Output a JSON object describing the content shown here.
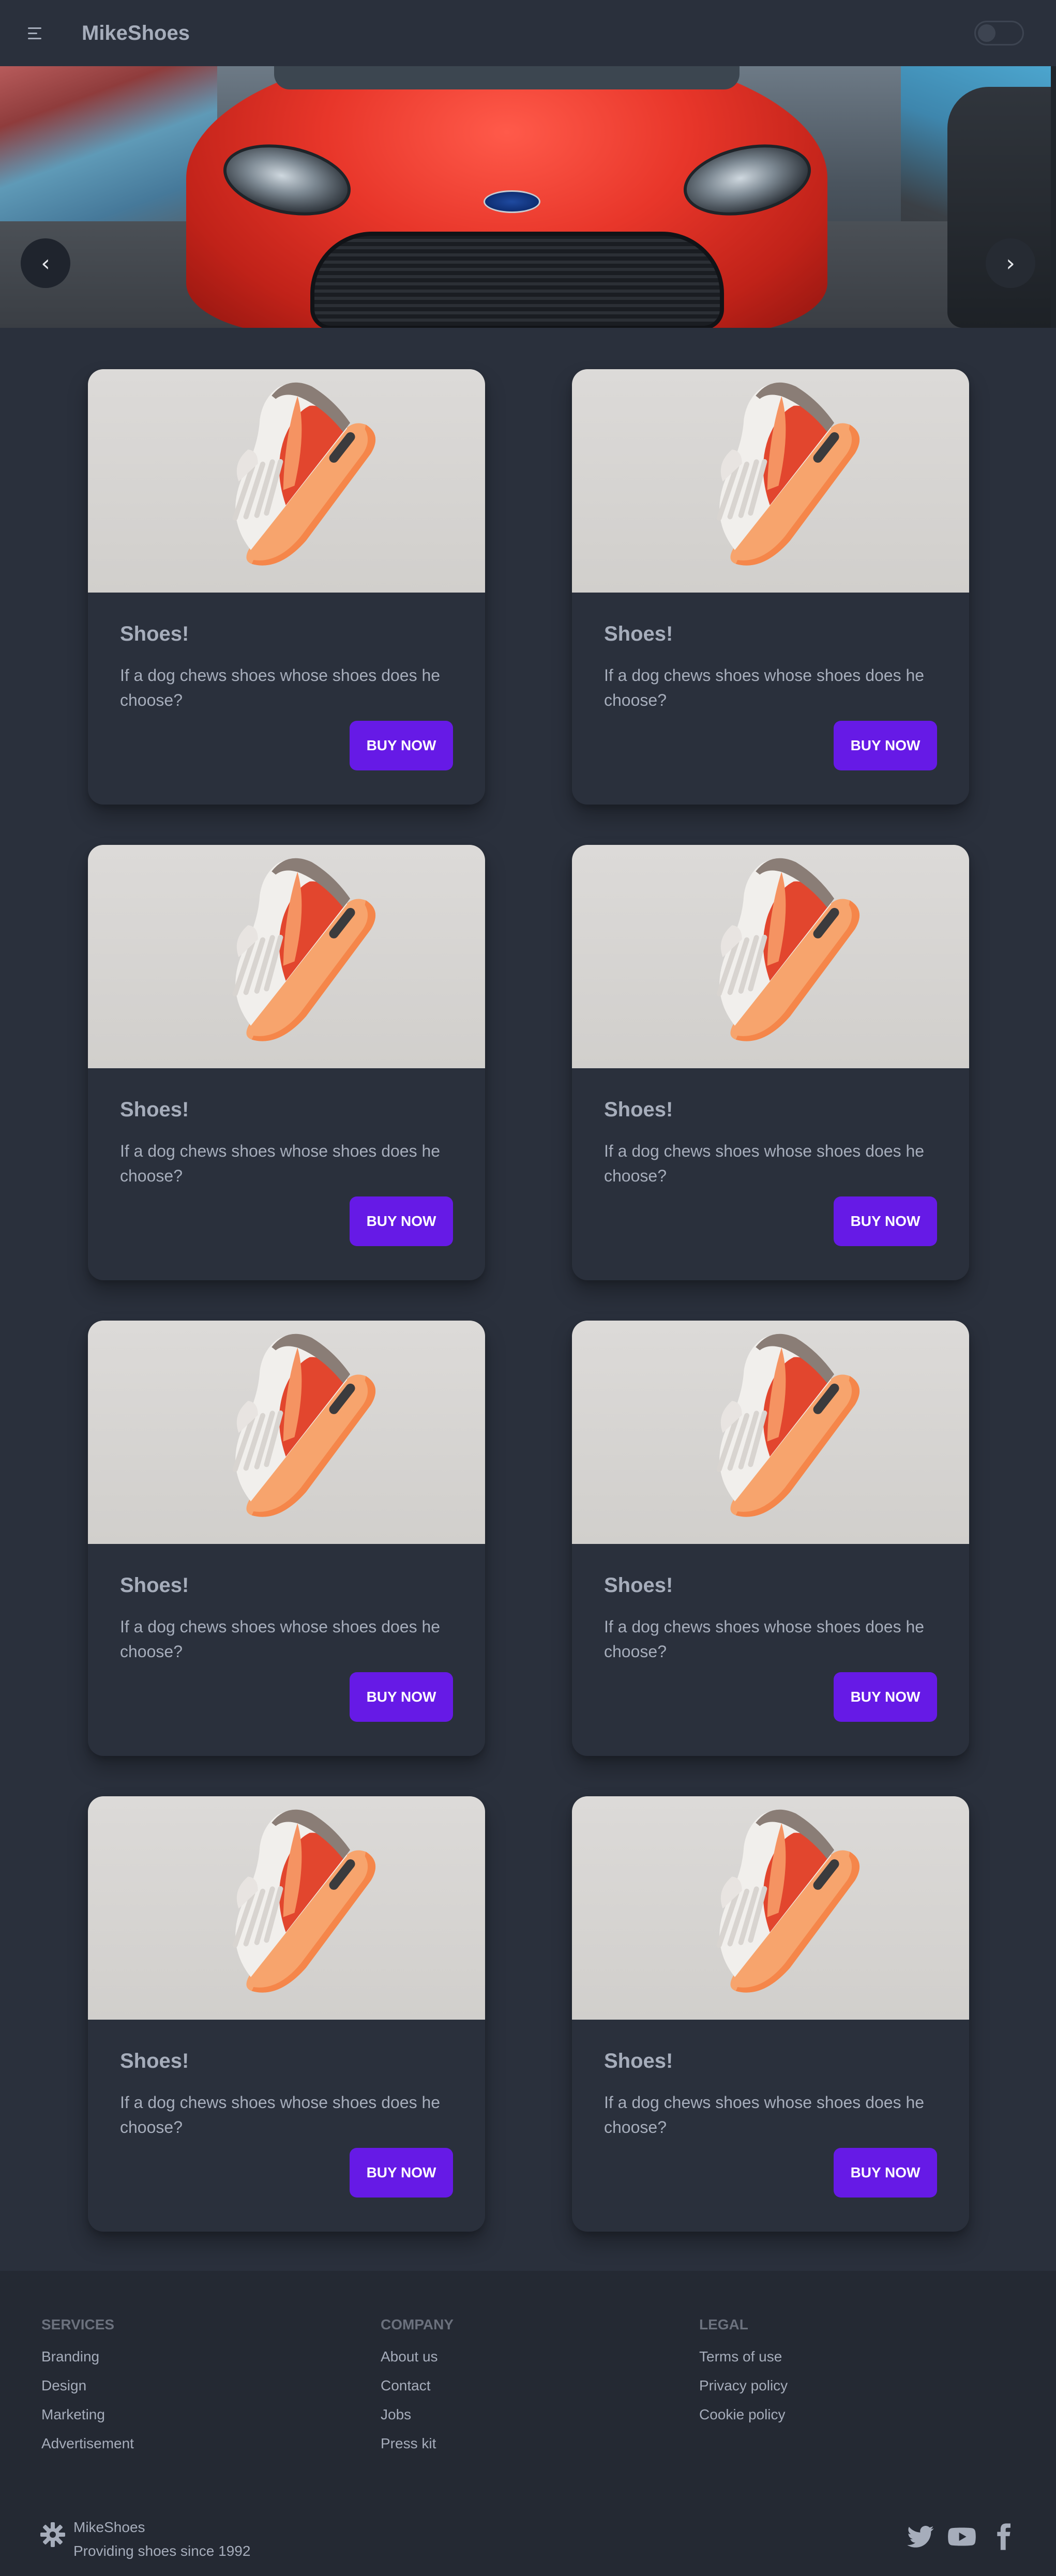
{
  "navbar": {
    "brand": "MikeShoes",
    "menu_icon": "menu-icon",
    "theme_toggle": "theme-toggle"
  },
  "carousel": {
    "prev_label": "‹",
    "next_label": "›",
    "image": "car-photo"
  },
  "products": [
    {
      "title": "Shoes!",
      "description": "If a dog chews shoes whose shoes does he choose?",
      "button": "Buy Now"
    },
    {
      "title": "Shoes!",
      "description": "If a dog chews shoes whose shoes does he choose?",
      "button": "Buy Now"
    },
    {
      "title": "Shoes!",
      "description": "If a dog chews shoes whose shoes does he choose?",
      "button": "Buy Now"
    },
    {
      "title": "Shoes!",
      "description": "If a dog chews shoes whose shoes does he choose?",
      "button": "Buy Now"
    },
    {
      "title": "Shoes!",
      "description": "If a dog chews shoes whose shoes does he choose?",
      "button": "Buy Now"
    },
    {
      "title": "Shoes!",
      "description": "If a dog chews shoes whose shoes does he choose?",
      "button": "Buy Now"
    },
    {
      "title": "Shoes!",
      "description": "If a dog chews shoes whose shoes does he choose?",
      "button": "Buy Now"
    },
    {
      "title": "Shoes!",
      "description": "If a dog chews shoes whose shoes does he choose?",
      "button": "Buy Now"
    }
  ],
  "footer": {
    "services": {
      "title": "Services",
      "links": [
        "Branding",
        "Design",
        "Marketing",
        "Advertisement"
      ]
    },
    "company": {
      "title": "Company",
      "links": [
        "About us",
        "Contact",
        "Jobs",
        "Press kit"
      ]
    },
    "legal": {
      "title": "Legal",
      "links": [
        "Terms of use",
        "Privacy policy",
        "Cookie policy"
      ]
    },
    "brand": "MikeShoes",
    "tagline": "Providing shoes since 1992",
    "social": [
      "twitter-icon",
      "youtube-icon",
      "facebook-icon"
    ]
  },
  "colors": {
    "background": "#2a303c",
    "footer": "#242933",
    "primary": "#661ae6",
    "text": "#a6adbb"
  }
}
